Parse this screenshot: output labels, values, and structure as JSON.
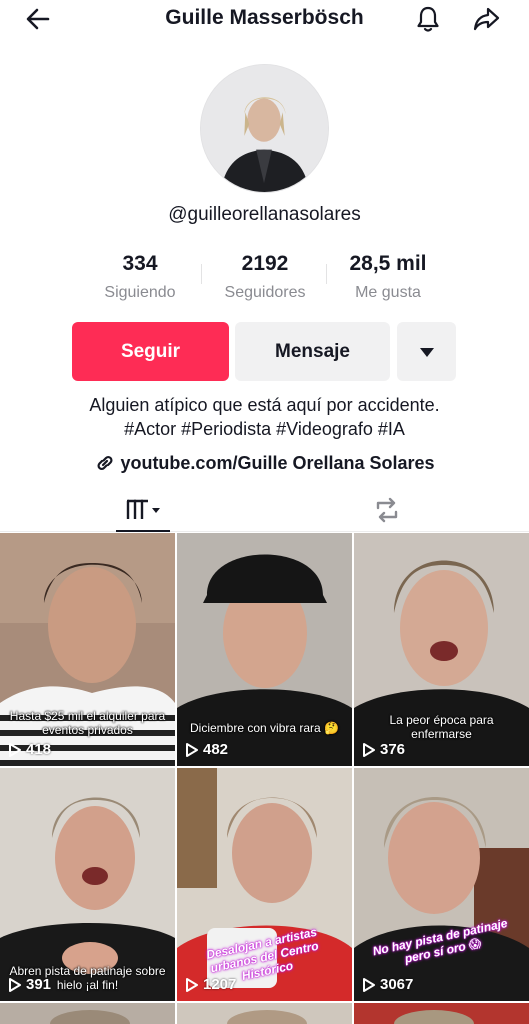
{
  "header": {
    "title": "Guille Masserbösch",
    "back_icon": "back-arrow-icon",
    "bell_icon": "bell-icon",
    "share_icon": "share-icon"
  },
  "profile": {
    "username": "@guilleorellanasolares",
    "stats": [
      {
        "value": "334",
        "label": "Siguiendo"
      },
      {
        "value": "2192",
        "label": "Seguidores"
      },
      {
        "value": "28,5 mil",
        "label": "Me gusta"
      }
    ],
    "buttons": {
      "follow": "Seguir",
      "message": "Mensaje",
      "more_icon": "caret-down-icon"
    },
    "bio_line1": "Alguien atípico que está aquí por accidente.",
    "bio_line2": "#Actor #Periodista #Videografo #IA",
    "link": "youtube.com/Guille Orellana Solares",
    "link_icon": "link-icon"
  },
  "tabs": {
    "videos_icon": "grid-icon",
    "repost_icon": "repost-icon"
  },
  "colors": {
    "accent": "#fe2c55",
    "secondary_button": "#f1f1f2",
    "muted_text": "#8a8b91"
  },
  "videos": [
    {
      "views": "418",
      "caption": "Hasta $25 mil el alquiler para eventos privados"
    },
    {
      "views": "482",
      "caption": "Diciembre con vibra rara 🤔"
    },
    {
      "views": "376",
      "caption": "La peor época para enfermarse"
    },
    {
      "views": "391",
      "caption": "Abren pista de patinaje sobre hielo ¡al fin!"
    },
    {
      "views": "1207",
      "caption": "Desalojan a artistas urbanos del Centro Histórico"
    },
    {
      "views": "3067",
      "caption": "No hay pista de patinaje pero sí oro 😱"
    }
  ]
}
